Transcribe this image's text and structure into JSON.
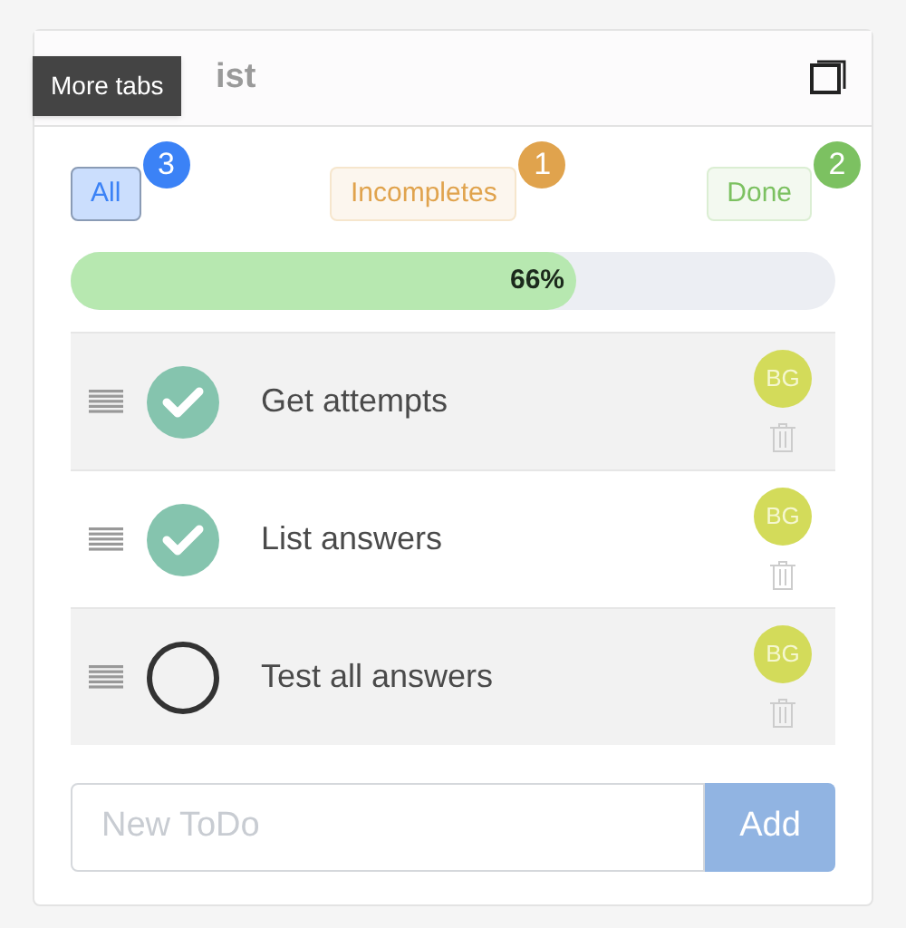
{
  "header": {
    "title": "ist",
    "tooltip": "More tabs"
  },
  "tabs": [
    {
      "label": "All",
      "count": "3",
      "color": "#3b82f6",
      "selected": true
    },
    {
      "label": "Incompletes",
      "count": "1",
      "color": "#e0a34d",
      "selected": false
    },
    {
      "label": "Done",
      "count": "2",
      "color": "#7cc161",
      "selected": false
    }
  ],
  "progress": {
    "level": 0.66,
    "reading": "66%"
  },
  "todos": [
    {
      "text": "Get attempts",
      "done": true,
      "assignee": "BG"
    },
    {
      "text": "List answers",
      "done": true,
      "assignee": "BG"
    },
    {
      "text": "Test all answers",
      "done": false,
      "assignee": "BG"
    }
  ],
  "new_todo": {
    "placeholder": "New ToDo",
    "button": "Add"
  }
}
